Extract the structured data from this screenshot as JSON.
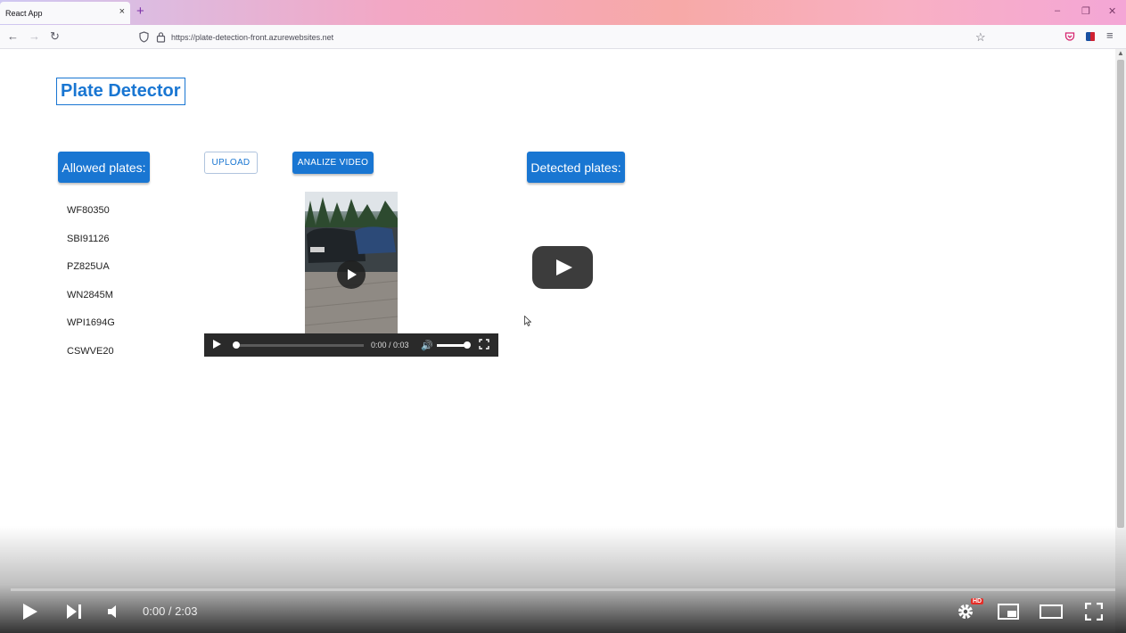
{
  "browser": {
    "tab_title": "React App",
    "tab_close": "×",
    "new_tab": "+",
    "url": "https://plate-detection-front.azurewebsites.net"
  },
  "app": {
    "title": "Plate Detector",
    "allowed_label": "Allowed plates:",
    "detected_label": "Detected plates:",
    "upload_label": "UPLOAD",
    "analize_label": "ANALIZE VIDEO",
    "allowed_plates": [
      "WF80350",
      "SBI91126",
      "PZ825UA",
      "WN2845M",
      "WPI1694G",
      "CSWVE20"
    ]
  },
  "embedded_video": {
    "time": "0:00 / 0:03"
  },
  "youtube": {
    "time": "0:00 / 2:03",
    "hd": "HD"
  }
}
